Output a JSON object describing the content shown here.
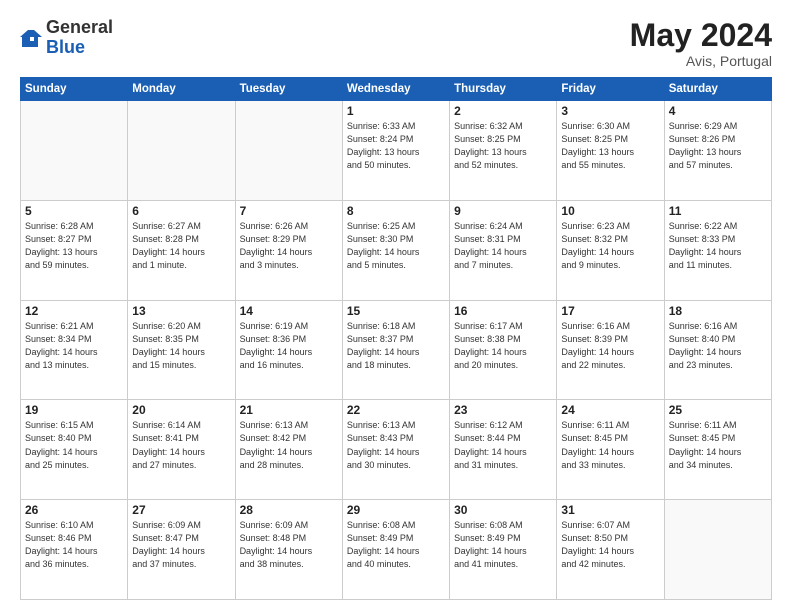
{
  "logo": {
    "general": "General",
    "blue": "Blue"
  },
  "header": {
    "month": "May 2024",
    "location": "Avis, Portugal"
  },
  "weekdays": [
    "Sunday",
    "Monday",
    "Tuesday",
    "Wednesday",
    "Thursday",
    "Friday",
    "Saturday"
  ],
  "weeks": [
    [
      {
        "day": "",
        "info": ""
      },
      {
        "day": "",
        "info": ""
      },
      {
        "day": "",
        "info": ""
      },
      {
        "day": "1",
        "info": "Sunrise: 6:33 AM\nSunset: 8:24 PM\nDaylight: 13 hours\nand 50 minutes."
      },
      {
        "day": "2",
        "info": "Sunrise: 6:32 AM\nSunset: 8:25 PM\nDaylight: 13 hours\nand 52 minutes."
      },
      {
        "day": "3",
        "info": "Sunrise: 6:30 AM\nSunset: 8:25 PM\nDaylight: 13 hours\nand 55 minutes."
      },
      {
        "day": "4",
        "info": "Sunrise: 6:29 AM\nSunset: 8:26 PM\nDaylight: 13 hours\nand 57 minutes."
      }
    ],
    [
      {
        "day": "5",
        "info": "Sunrise: 6:28 AM\nSunset: 8:27 PM\nDaylight: 13 hours\nand 59 minutes."
      },
      {
        "day": "6",
        "info": "Sunrise: 6:27 AM\nSunset: 8:28 PM\nDaylight: 14 hours\nand 1 minute."
      },
      {
        "day": "7",
        "info": "Sunrise: 6:26 AM\nSunset: 8:29 PM\nDaylight: 14 hours\nand 3 minutes."
      },
      {
        "day": "8",
        "info": "Sunrise: 6:25 AM\nSunset: 8:30 PM\nDaylight: 14 hours\nand 5 minutes."
      },
      {
        "day": "9",
        "info": "Sunrise: 6:24 AM\nSunset: 8:31 PM\nDaylight: 14 hours\nand 7 minutes."
      },
      {
        "day": "10",
        "info": "Sunrise: 6:23 AM\nSunset: 8:32 PM\nDaylight: 14 hours\nand 9 minutes."
      },
      {
        "day": "11",
        "info": "Sunrise: 6:22 AM\nSunset: 8:33 PM\nDaylight: 14 hours\nand 11 minutes."
      }
    ],
    [
      {
        "day": "12",
        "info": "Sunrise: 6:21 AM\nSunset: 8:34 PM\nDaylight: 14 hours\nand 13 minutes."
      },
      {
        "day": "13",
        "info": "Sunrise: 6:20 AM\nSunset: 8:35 PM\nDaylight: 14 hours\nand 15 minutes."
      },
      {
        "day": "14",
        "info": "Sunrise: 6:19 AM\nSunset: 8:36 PM\nDaylight: 14 hours\nand 16 minutes."
      },
      {
        "day": "15",
        "info": "Sunrise: 6:18 AM\nSunset: 8:37 PM\nDaylight: 14 hours\nand 18 minutes."
      },
      {
        "day": "16",
        "info": "Sunrise: 6:17 AM\nSunset: 8:38 PM\nDaylight: 14 hours\nand 20 minutes."
      },
      {
        "day": "17",
        "info": "Sunrise: 6:16 AM\nSunset: 8:39 PM\nDaylight: 14 hours\nand 22 minutes."
      },
      {
        "day": "18",
        "info": "Sunrise: 6:16 AM\nSunset: 8:40 PM\nDaylight: 14 hours\nand 23 minutes."
      }
    ],
    [
      {
        "day": "19",
        "info": "Sunrise: 6:15 AM\nSunset: 8:40 PM\nDaylight: 14 hours\nand 25 minutes."
      },
      {
        "day": "20",
        "info": "Sunrise: 6:14 AM\nSunset: 8:41 PM\nDaylight: 14 hours\nand 27 minutes."
      },
      {
        "day": "21",
        "info": "Sunrise: 6:13 AM\nSunset: 8:42 PM\nDaylight: 14 hours\nand 28 minutes."
      },
      {
        "day": "22",
        "info": "Sunrise: 6:13 AM\nSunset: 8:43 PM\nDaylight: 14 hours\nand 30 minutes."
      },
      {
        "day": "23",
        "info": "Sunrise: 6:12 AM\nSunset: 8:44 PM\nDaylight: 14 hours\nand 31 minutes."
      },
      {
        "day": "24",
        "info": "Sunrise: 6:11 AM\nSunset: 8:45 PM\nDaylight: 14 hours\nand 33 minutes."
      },
      {
        "day": "25",
        "info": "Sunrise: 6:11 AM\nSunset: 8:45 PM\nDaylight: 14 hours\nand 34 minutes."
      }
    ],
    [
      {
        "day": "26",
        "info": "Sunrise: 6:10 AM\nSunset: 8:46 PM\nDaylight: 14 hours\nand 36 minutes."
      },
      {
        "day": "27",
        "info": "Sunrise: 6:09 AM\nSunset: 8:47 PM\nDaylight: 14 hours\nand 37 minutes."
      },
      {
        "day": "28",
        "info": "Sunrise: 6:09 AM\nSunset: 8:48 PM\nDaylight: 14 hours\nand 38 minutes."
      },
      {
        "day": "29",
        "info": "Sunrise: 6:08 AM\nSunset: 8:49 PM\nDaylight: 14 hours\nand 40 minutes."
      },
      {
        "day": "30",
        "info": "Sunrise: 6:08 AM\nSunset: 8:49 PM\nDaylight: 14 hours\nand 41 minutes."
      },
      {
        "day": "31",
        "info": "Sunrise: 6:07 AM\nSunset: 8:50 PM\nDaylight: 14 hours\nand 42 minutes."
      },
      {
        "day": "",
        "info": ""
      }
    ]
  ]
}
